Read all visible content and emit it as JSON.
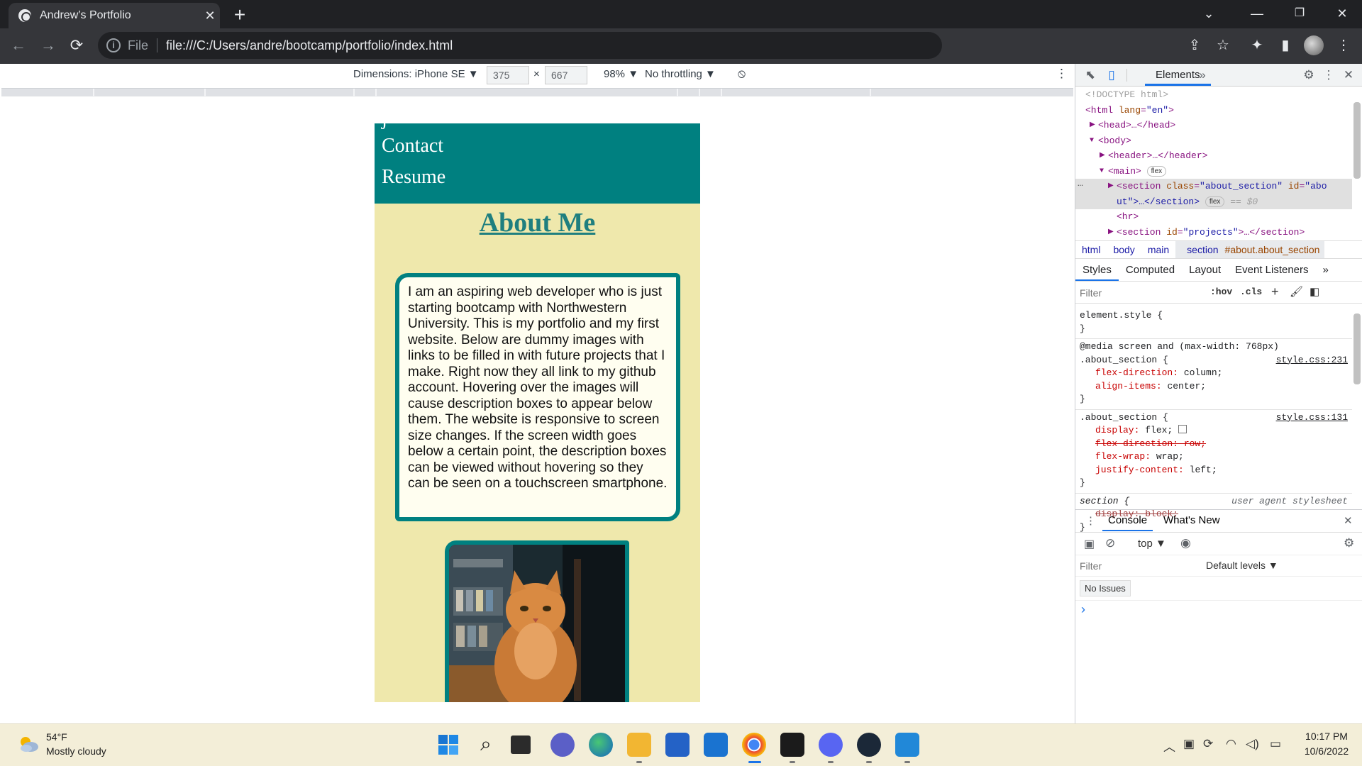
{
  "browser": {
    "tab_title": "Andrew’s Portfolio",
    "tab_close": "✕",
    "new_tab": "+",
    "window_controls": {
      "dropdown": "⌄",
      "minimize": "—",
      "restore": "❐",
      "close": "✕"
    },
    "nav": {
      "back": "←",
      "forward": "→",
      "reload": "⟳"
    },
    "address": {
      "scheme_label": "File",
      "url": "file:///C:/Users/andre/bootcamp/portfolio/index.html"
    }
  },
  "device_toolbar": {
    "dimensions_label": "Dimensions: iPhone SE ▼",
    "width": "375",
    "times": "×",
    "height": "667",
    "zoom": "98% ▼",
    "throttling": "No throttling ▼"
  },
  "site": {
    "nav_links": [
      "Contact",
      "Resume"
    ],
    "about_title": "About Me",
    "about_text": "I am an aspiring web developer who is just starting bootcamp with Northwestern University. This is my portfolio and my first website. Below are dummy images with links to be filled in with future projects that I make. Right now they all link to my github account. Hovering over the images will cause description boxes to appear below them. The website is responsive to screen size changes. If the screen width goes below a certain point, the description boxes can be viewed without hovering so they can be seen on a touchscreen smartphone."
  },
  "devtools": {
    "tab_elements": "Elements",
    "more_tabs": "»",
    "dom_lines": {
      "doctype": "<!DOCTYPE html>",
      "html_open_tag": "<html ",
      "html_attr": "lang",
      "html_val": "\"en\"",
      "html_close": ">",
      "head": "<head>…</head>",
      "body": "<body>",
      "header": "<header>…</header>",
      "main": "<main>",
      "main_pill": "flex",
      "section_tag": "<section ",
      "section_class_attr": "class",
      "section_class_val": "\"about_section\"",
      "section_id_attr": " id",
      "section_id_val": "\"abo",
      "section_cont": "ut\">…</section>",
      "section_pill": "flex",
      "section_eq": "== $0",
      "hr": "<hr>",
      "projects_tag": "<section ",
      "projects_attr": "id",
      "projects_val": "\"projects\"",
      "projects_close": ">…</section>"
    },
    "breadcrumbs": [
      "html",
      "body",
      "main"
    ],
    "breadcrumb_selected": "section",
    "breadcrumb_selected_suffix": "#about.about_section",
    "style_tabs": [
      "Styles",
      "Computed",
      "Layout",
      "Event Listeners",
      "»"
    ],
    "filter_placeholder": "Filter",
    "hov": ":hov",
    "cls": ".cls",
    "rules": {
      "element_style": "element.style {",
      "close": "}",
      "media": "@media screen and (max-width: 768px)",
      "about_selector": ".about_section {",
      "src1": "style.css:231",
      "src2": "style.css:131",
      "flex_direction_prop": "flex-direction",
      "column": "column;",
      "align_items_prop": "align-items",
      "center": "center;",
      "display_prop": "display",
      "flex": "flex;",
      "flex_direction_row": "flex-direction: row;",
      "flex_wrap_prop": "flex-wrap",
      "wrap": "wrap;",
      "justify_prop": "justify-content",
      "left": "left;",
      "section_selector": "section {",
      "ua_label": "user agent stylesheet",
      "display_block": "display: block;"
    },
    "console": {
      "tab_console": "Console",
      "tab_whats_new": "What's New",
      "context": "top ▼",
      "filter_placeholder": "Filter",
      "levels": "Default levels ▼",
      "issues": "No Issues",
      "prompt": "›"
    }
  },
  "taskbar": {
    "temperature": "54°F",
    "condition": "Mostly cloudy",
    "time": "10:17 PM",
    "date": "10/6/2022"
  }
}
